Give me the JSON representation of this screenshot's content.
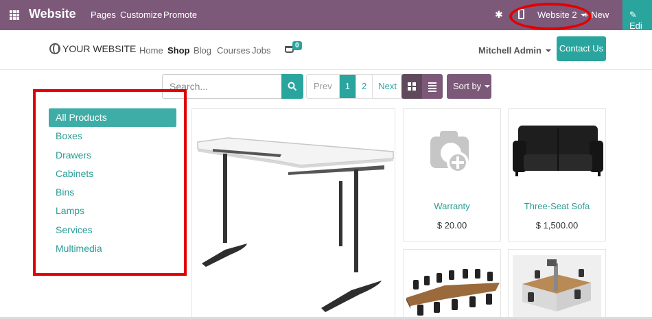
{
  "admin_bar": {
    "brand": "Website",
    "menu": [
      "Pages",
      "Customize",
      "Promote"
    ],
    "website_switch": "Website 2",
    "new_label": "New",
    "edit_label": "Edi"
  },
  "site_header": {
    "logo": "YOUR WEBSITE",
    "nav": [
      "Home",
      "Shop",
      "Blog",
      "Courses",
      "Jobs"
    ],
    "active_nav": "Shop",
    "cart_count": "0",
    "user": "Mitchell Admin",
    "contact": "Contact Us"
  },
  "toolbar": {
    "search_placeholder": "Search...",
    "pager": {
      "prev": "Prev",
      "pages": [
        "1",
        "2"
      ],
      "current": "1",
      "next": "Next"
    },
    "sort_label": "Sort by"
  },
  "categories": {
    "items": [
      "All Products",
      "Boxes",
      "Drawers",
      "Cabinets",
      "Bins",
      "Lamps",
      "Services",
      "Multimedia"
    ],
    "active": "All Products"
  },
  "products": [
    {
      "name": "Warranty",
      "price": "$ 20.00"
    },
    {
      "name": "Three-Seat Sofa",
      "price": "$ 1,500.00"
    }
  ],
  "colors": {
    "admin_bar": "#7c5979",
    "accent": "#2aa59e",
    "highlight": "#e30000"
  }
}
